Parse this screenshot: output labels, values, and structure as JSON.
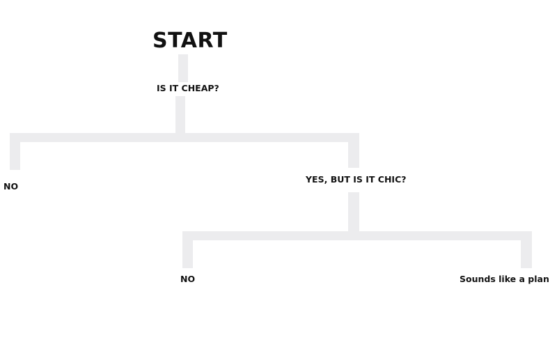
{
  "flowchart": {
    "start": "START",
    "question_1": "IS IT CHEAP?",
    "answer_1_no": "NO",
    "question_2": "YES, BUT IS IT CHIC?",
    "answer_2_no": "NO",
    "answer_2_yes": "Sounds like a plan"
  },
  "colors": {
    "connector": "#ececee",
    "text": "#111111",
    "background": "#ffffff"
  }
}
